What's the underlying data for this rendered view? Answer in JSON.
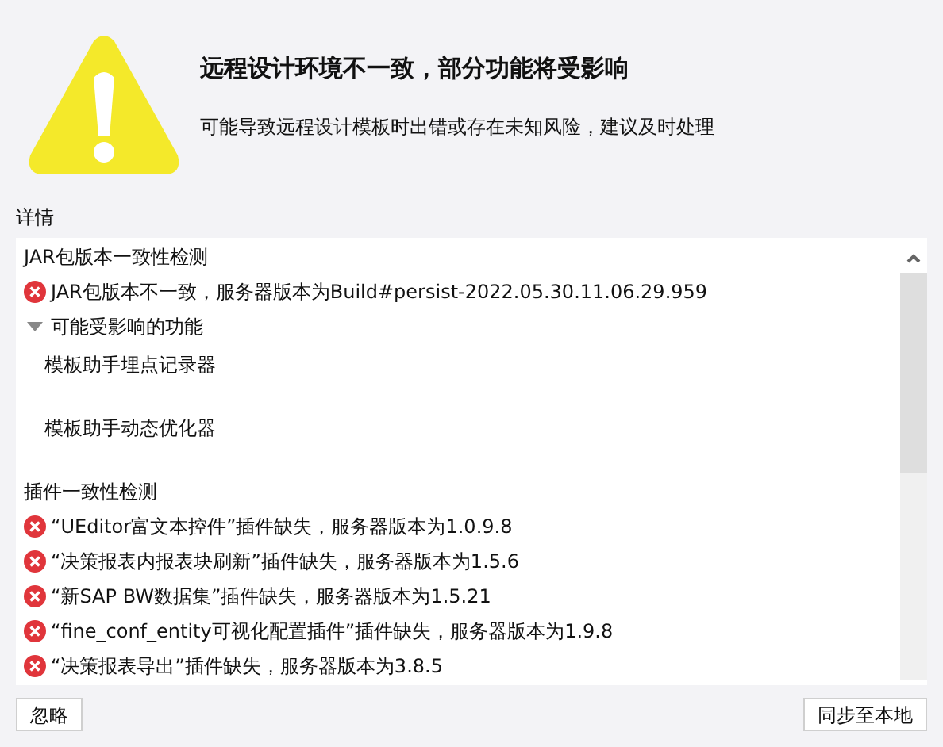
{
  "title": "远程设计环境不一致，部分功能将受影响",
  "message": "可能导致远程设计模板时出错或存在未知风险，建议及时处理",
  "details_label": "详情",
  "details": [
    {
      "kind": "heading",
      "text": "JAR包版本一致性检测"
    },
    {
      "kind": "error",
      "text": "JAR包版本不一致，服务器版本为Build#persist-2022.05.30.11.06.29.959"
    },
    {
      "kind": "group",
      "text": "可能受影响的功能",
      "expanded": true,
      "children": [
        {
          "text": "模板助手埋点记录器"
        },
        {
          "text": "模板助手动态优化器"
        }
      ]
    },
    {
      "kind": "heading",
      "text": "插件一致性检测"
    },
    {
      "kind": "error",
      "text": "“UEditor富文本控件”插件缺失，服务器版本为1.0.9.8"
    },
    {
      "kind": "error",
      "text": "“决策报表内报表块刷新”插件缺失，服务器版本为1.5.6"
    },
    {
      "kind": "error",
      "text": "“新SAP BW数据集”插件缺失，服务器版本为1.5.21"
    },
    {
      "kind": "error",
      "text": "“fine_conf_entity可视化配置插件”插件缺失，服务器版本为1.9.8"
    },
    {
      "kind": "error",
      "text": "“决策报表导出”插件缺失，服务器版本为3.8.5"
    }
  ],
  "buttons": [
    {
      "label": "忽略"
    },
    {
      "label": "同步至本地"
    }
  ]
}
